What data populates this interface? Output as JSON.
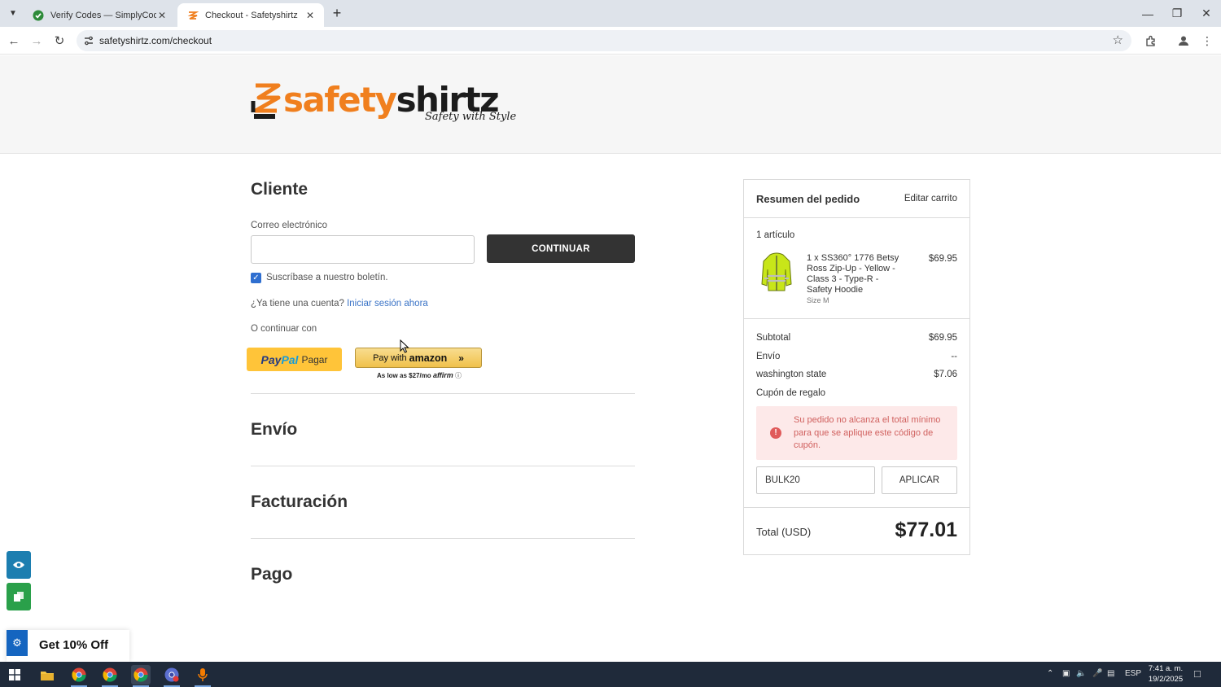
{
  "browser": {
    "tabs": [
      {
        "title": "Verify Codes — SimplyCodes",
        "active": false
      },
      {
        "title": "Checkout - Safetyshirtz",
        "active": true
      }
    ],
    "url": "safetyshirtz.com/checkout"
  },
  "logo": {
    "brand_part1": "safety",
    "brand_part2": "shirtz",
    "tagline": "Safety with Style"
  },
  "customer": {
    "heading": "Cliente",
    "email_label": "Correo electrónico",
    "email_value": "",
    "continue_label": "CONTINUAR",
    "newsletter_label": "Suscríbase a nuestro boletín.",
    "newsletter_checked": true,
    "account_prompt": "¿Ya tiene una cuenta?",
    "signin_link": "Iniciar sesión ahora",
    "or_continue": "O continuar con",
    "paypal_label": "Pagar",
    "amazon_label": "Pay with",
    "amazon_brand": "amazon",
    "affirm_note": "As low as $27/mo",
    "affirm_brand": "affirm"
  },
  "sections": {
    "shipping": "Envío",
    "billing": "Facturación",
    "payment": "Pago"
  },
  "summary": {
    "heading": "Resumen del pedido",
    "edit_cart": "Editar carrito",
    "item_count": "1 artículo",
    "item": {
      "name": "1 x SS360° 1776 Betsy Ross Zip-Up - Yellow - Class 3 - Type-R - Safety Hoodie",
      "name_lines": [
        "1 x SS360° 1776 Betsy",
        "Ross Zip-Up - Yellow -",
        "Class 3 - Type-R -",
        "Safety Hoodie"
      ],
      "option": "Size M",
      "price": "$69.95"
    },
    "subtotal_label": "Subtotal",
    "subtotal_value": "$69.95",
    "shipping_label": "Envío",
    "shipping_value": "--",
    "tax_label": "washington state",
    "tax_value": "$7.06",
    "coupon_link": "Cupón de regalo",
    "coupon_error": "Su pedido no alcanza el total mínimo para que se aplique este código de cupón.",
    "coupon_code": "BULK20",
    "apply_label": "APLICAR",
    "total_label": "Total (USD)",
    "total_value": "$77.01"
  },
  "promo": {
    "label": "Get 10% Off"
  },
  "taskbar": {
    "language": "ESP",
    "time": "7:41 a. m.",
    "date": "19/2/2025"
  },
  "colors": {
    "brand_orange": "#f07f1e",
    "link_blue": "#3a73c6",
    "paypal_yellow": "#ffc439",
    "error_bg": "#fde9e9",
    "error_text": "#d0605e"
  }
}
